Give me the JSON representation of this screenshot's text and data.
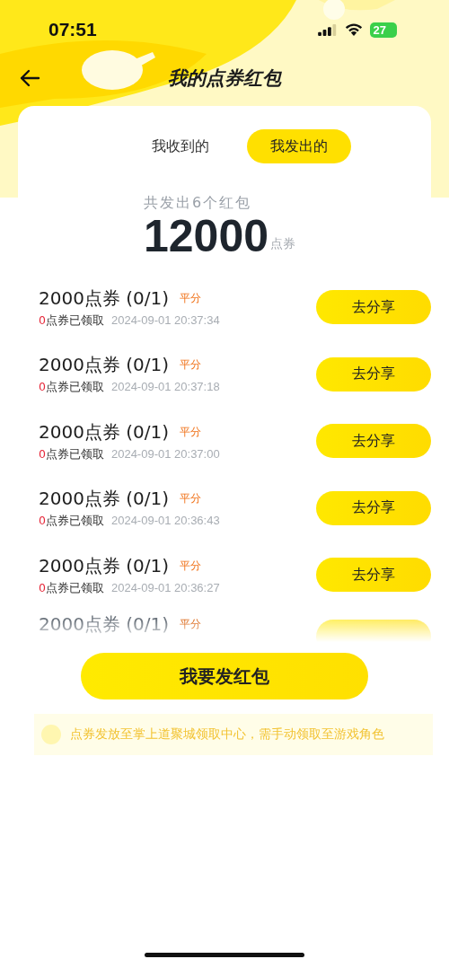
{
  "status_bar": {
    "time": "07:51",
    "battery": "27"
  },
  "nav": {
    "title": "我的点券红包"
  },
  "tabs": [
    {
      "label": "我收到的",
      "selected": false
    },
    {
      "label": "我发出的",
      "selected": true
    }
  ],
  "summary": {
    "caption": "共发出6个红包",
    "amount": "12000",
    "unit": "点券"
  },
  "packets": [
    {
      "kind": "full",
      "title": "2000点券 (0/1)",
      "tag": "平分",
      "claimed": "0",
      "claimed_label": "点券已领取",
      "time": "2024-09-01 20:37:34",
      "action": "去分享"
    },
    {
      "kind": "full",
      "title": "2000点券 (0/1)",
      "tag": "平分",
      "claimed": "0",
      "claimed_label": "点券已领取",
      "time": "2024-09-01 20:37:18",
      "action": "去分享"
    },
    {
      "kind": "full",
      "title": "2000点券 (0/1)",
      "tag": "平分",
      "claimed": "0",
      "claimed_label": "点券已领取",
      "time": "2024-09-01 20:37:00",
      "action": "去分享"
    },
    {
      "kind": "full",
      "title": "2000点券 (0/1)",
      "tag": "平分",
      "claimed": "0",
      "claimed_label": "点券已领取",
      "time": "2024-09-01 20:36:43",
      "action": "去分享"
    },
    {
      "kind": "full",
      "title": "2000点券 (0/1)",
      "tag": "平分",
      "claimed": "0",
      "claimed_label": "点券已领取",
      "time": "2024-09-01 20:36:27",
      "action": "去分享"
    },
    {
      "kind": "faded",
      "title": "2000点券 (0/1)",
      "tag": "平分"
    }
  ],
  "send_button": "我要发红包",
  "notice": "点券发放至掌上道聚城领取中心，需手动领取至游戏角色"
}
